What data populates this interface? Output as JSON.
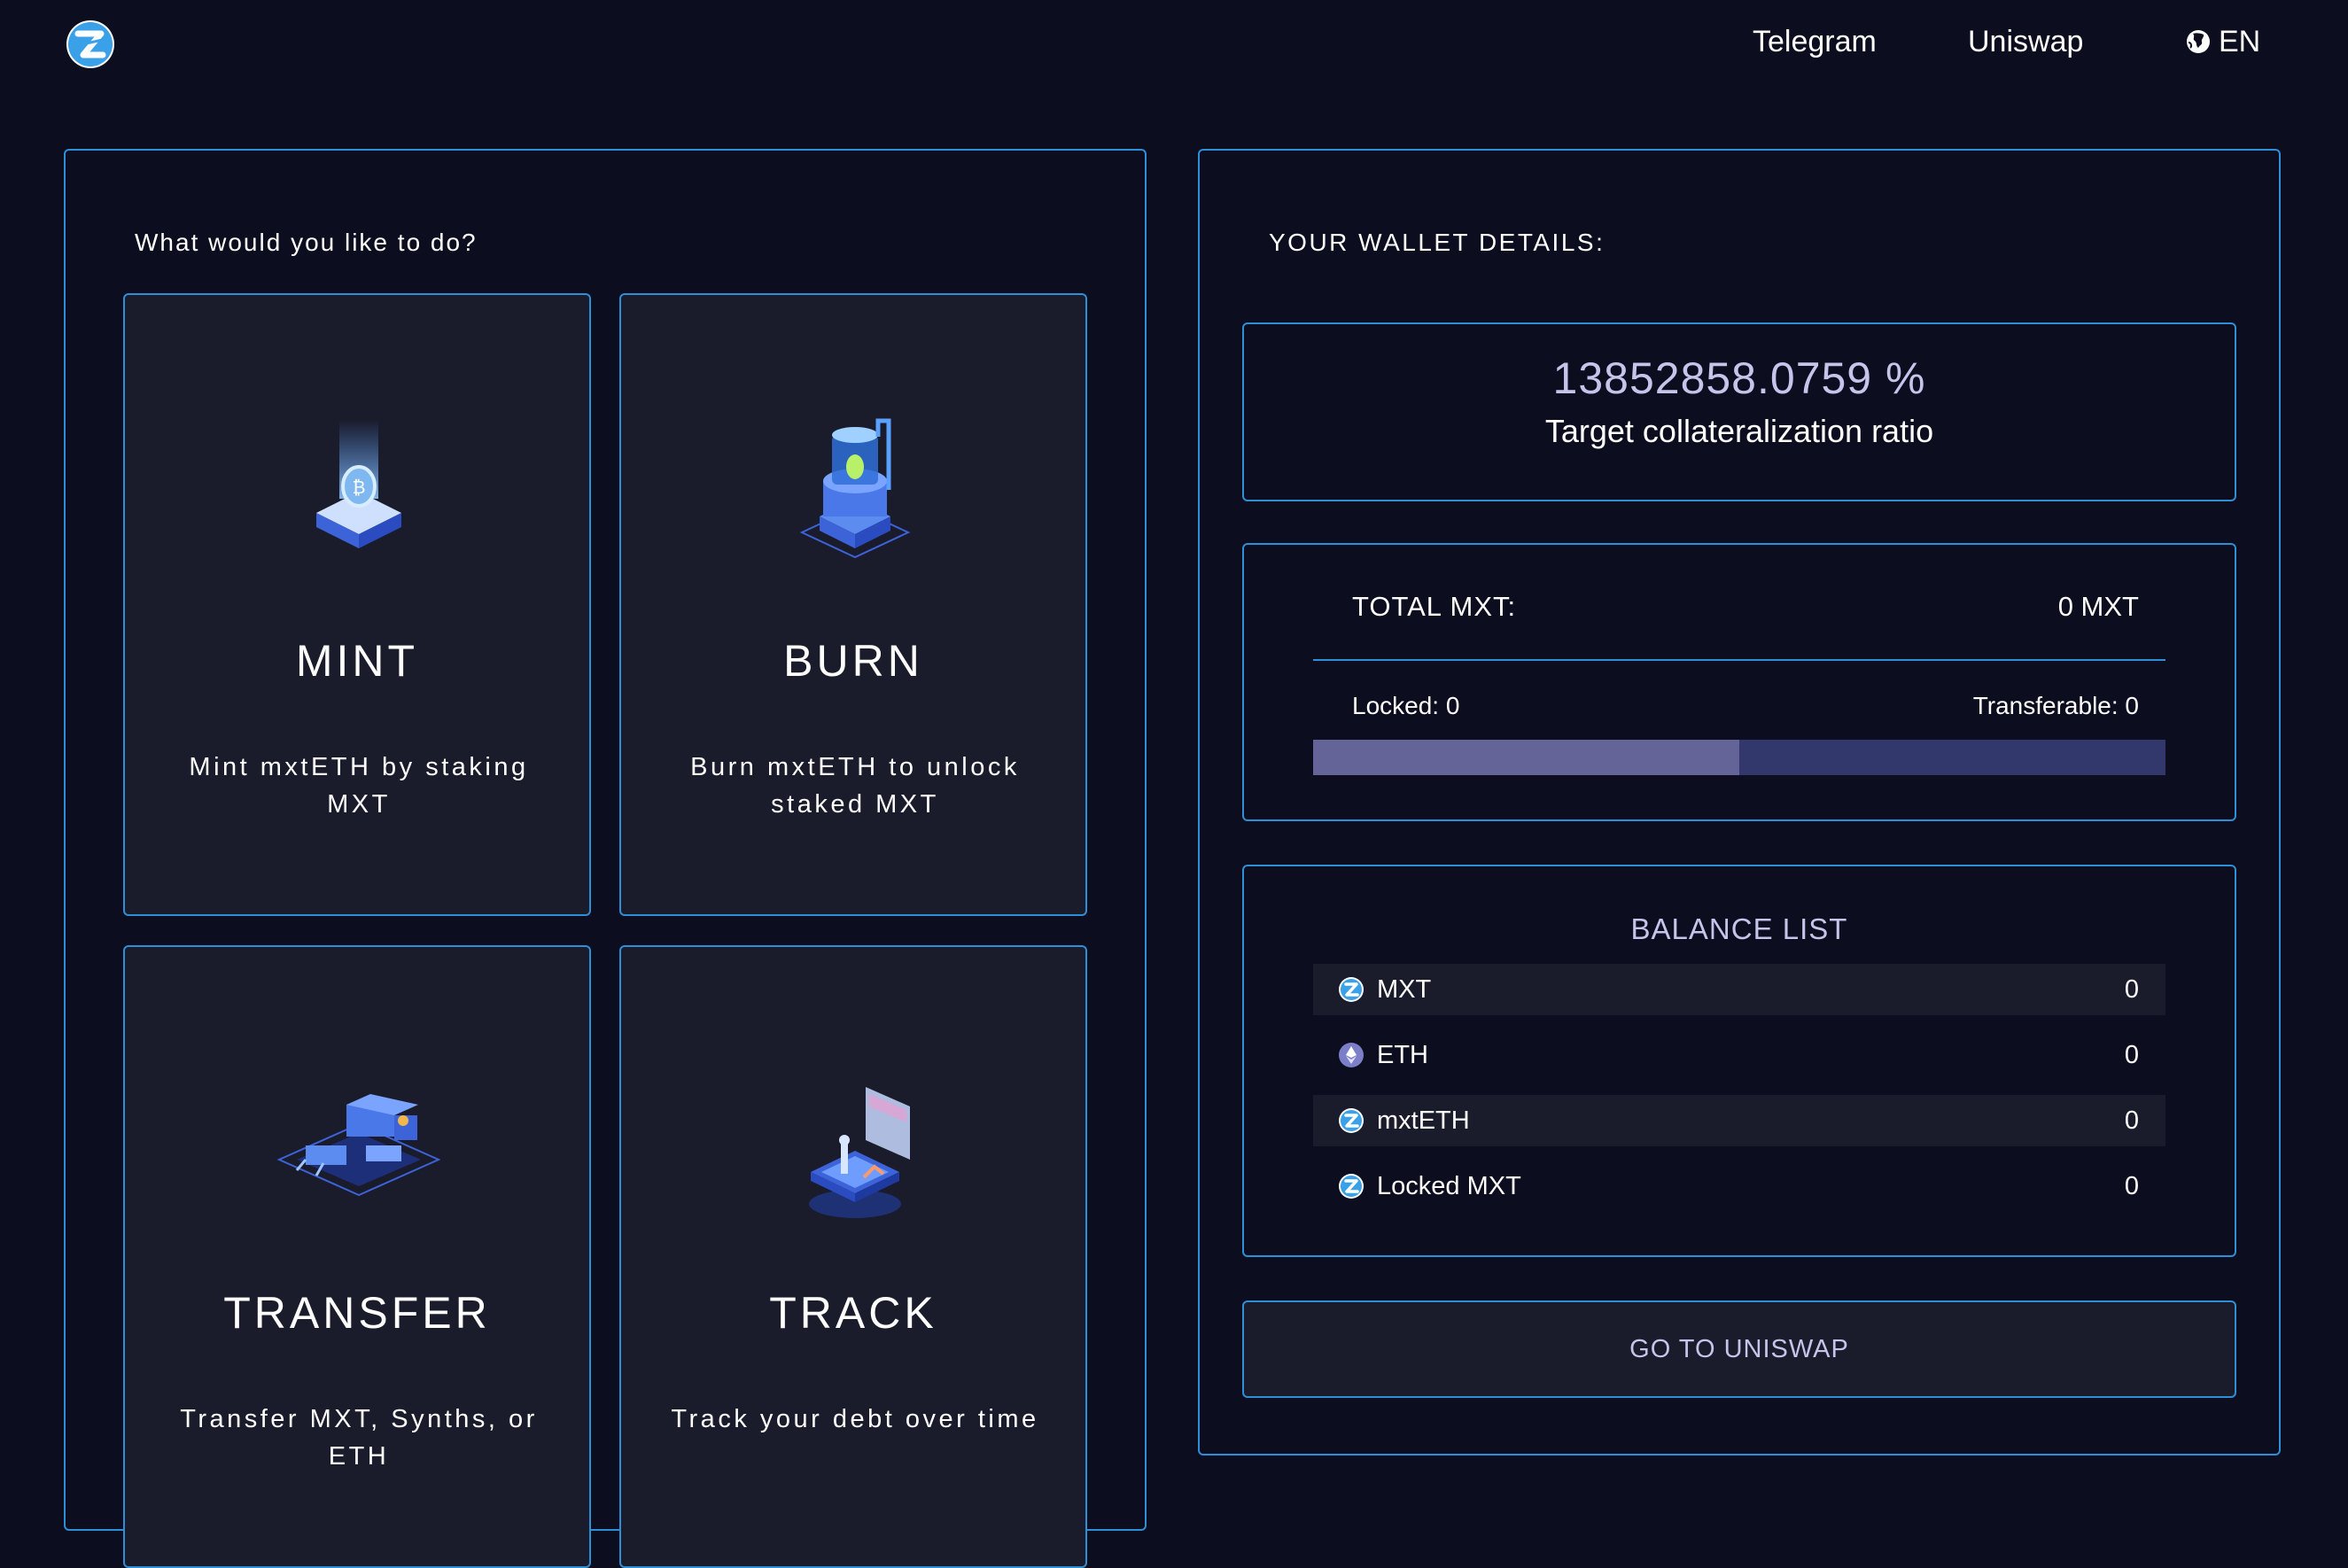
{
  "header": {
    "nav": {
      "telegram": "Telegram",
      "uniswap": "Uniswap",
      "language": "EN"
    }
  },
  "actions": {
    "heading": "What would you like to do?",
    "cards": [
      {
        "title": "MINT",
        "description": "Mint mxtETH by staking MXT"
      },
      {
        "title": "BURN",
        "description": "Burn mxtETH to unlock staked MXT"
      },
      {
        "title": "TRANSFER",
        "description": "Transfer MXT, Synths, or ETH"
      },
      {
        "title": "TRACK",
        "description": "Track your debt over time"
      }
    ]
  },
  "wallet": {
    "heading": "YOUR WALLET DETAILS:",
    "ratio_value": "13852858.0759 %",
    "ratio_label": "Target collateralization ratio",
    "total_label": "TOTAL MXT:",
    "total_value": "0 MXT",
    "locked_label": "Locked: 0",
    "transferable_label": "Transferable: 0",
    "locked_fraction": 0.5,
    "balance_title": "BALANCE LIST",
    "balances": [
      {
        "token": "MXT",
        "amount": "0",
        "icon": "mxt-token-icon"
      },
      {
        "token": "ETH",
        "amount": "0",
        "icon": "eth-token-icon"
      },
      {
        "token": "mxtETH",
        "amount": "0",
        "icon": "mxteth-token-icon"
      },
      {
        "token": "Locked MXT",
        "amount": "0",
        "icon": "locked-mxt-token-icon"
      }
    ],
    "uniswap_button": "GO TO UNISWAP"
  },
  "colors": {
    "background": "#0c0d1e",
    "card": "#1a1b2b",
    "border": "#2f8fd6",
    "accent_text": "#c5c4ea",
    "progress_fill": "#646499",
    "progress_track": "#33386c"
  }
}
